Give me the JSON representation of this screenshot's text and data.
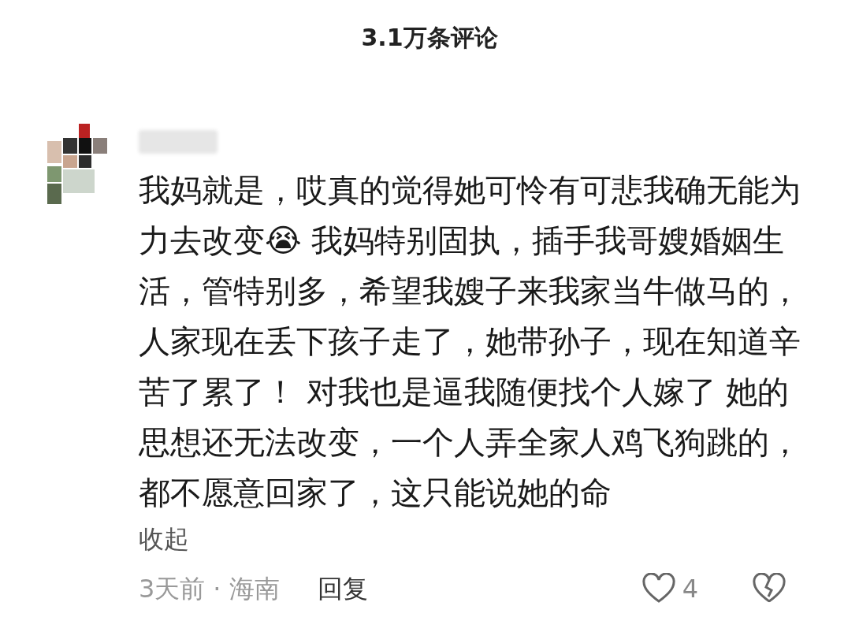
{
  "header": {
    "title": "3.1万条评论"
  },
  "comment": {
    "text": "我妈就是，哎真的觉得她可怜有可悲我确无能为力去改变😭 我妈特别固执，插手我哥嫂婚姻生活，管特别多，希望我嫂子来我家当牛做马的，人家现在丢下孩子走了，她带孙子，现在知道辛苦了累了！ 对我也是逼我随便找个人嫁了 她的思想还无法改变，一个人弄全家人鸡飞狗跳的，都不愿意回家了，这只能说她的命",
    "collapse": "收起",
    "time": "3天前",
    "separator": "·",
    "location": "海南",
    "reply": "回复",
    "likes": "4",
    "liked": false
  }
}
